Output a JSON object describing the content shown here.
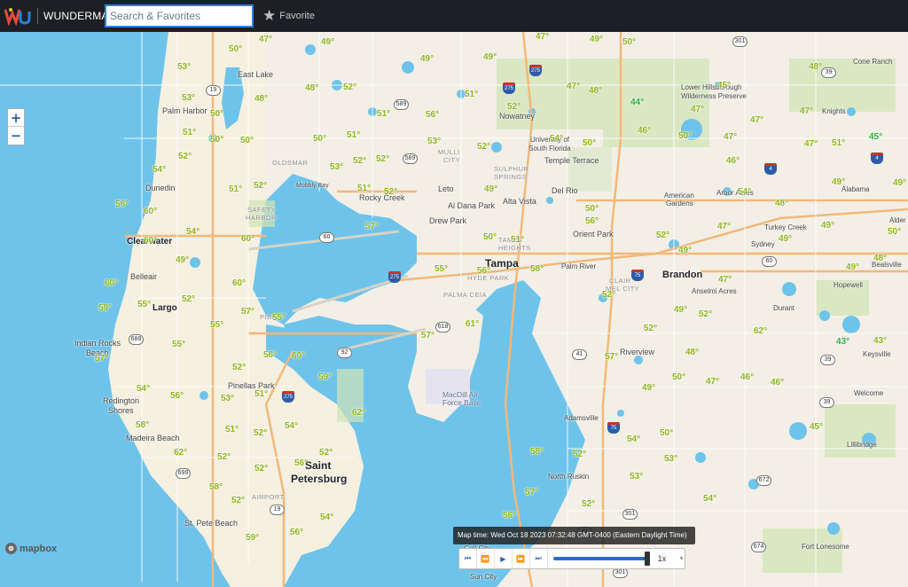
{
  "header": {
    "logo_text": "WUNDERMAP",
    "search_placeholder": "Search & Favorites",
    "favorite_label": "Favorite"
  },
  "map": {
    "attribution": "mapbox",
    "zoom_in": "+",
    "zoom_out": "−",
    "cities_major": [
      {
        "name": "Tampa"
      },
      {
        "name": "Saint"
      },
      {
        "name": "Petersburg"
      },
      {
        "name": "Brandon"
      },
      {
        "name": "Clearwater"
      },
      {
        "name": "Largo"
      }
    ],
    "places": [
      "East Lake",
      "Palm Harbor",
      "Dunedin",
      "Belleair",
      "Indian Rocks",
      "Beach",
      "Redington",
      "Shores",
      "Madeira Beach",
      "Pinellas Park",
      "St. Pete Beach",
      "Oldsmar",
      "Mobbly Bay",
      "Rocky Creek",
      "Leto",
      "Drew Park",
      "Al Dana Park",
      "Alta Vista",
      "Nowatney",
      "University of",
      "South Florida",
      "Temple Terrace",
      "Del Rio",
      "Orient Park",
      "Palm River",
      "Riverview",
      "Adamsville",
      "North Ruskin",
      "Sun City",
      "Lower Hillsborough",
      "Wilderness Preserve",
      "Knights",
      "Cone Ranch",
      "Alabama",
      "American",
      "Gardens",
      "Arbor Acres",
      "Turkey Creek",
      "Sydney",
      "Hopewell",
      "Durant",
      "Anselmi Acres",
      "Keysville",
      "Welcome",
      "Lillibridge",
      "Fort Lonesome",
      "Bealsville",
      "Alder",
      "Mulli",
      "City",
      "MacDill Air",
      "Force Base",
      "Gull City"
    ],
    "districts": [
      "Safety",
      "Harbor",
      "Sulphur",
      "Springs",
      "Tampa",
      "Heights",
      "Hyde Park",
      "Palma Ceia",
      "Clair",
      "Mel City",
      "Pier",
      "Airport",
      "Oldsmar"
    ],
    "shields": [
      "19",
      "589",
      "589",
      "275",
      "60",
      "275",
      "92",
      "688",
      "699",
      "19",
      "618",
      "41",
      "75",
      "75",
      "301",
      "39",
      "39",
      "39",
      "60",
      "672",
      "674",
      "301",
      "301",
      "41",
      "4",
      "4",
      "275",
      "275"
    ],
    "temperatures": [
      "47°",
      "48°",
      "51°",
      "50°",
      "49°",
      "49°",
      "53°",
      "52°",
      "54°",
      "55°",
      "57°",
      "56°",
      "60°",
      "58°",
      "59°",
      "44°",
      "45°",
      "46°",
      "43°",
      "61°",
      "62°"
    ]
  },
  "player": {
    "map_time": "Map time: Wed Oct 18 2023 07:32:48 GMT-0400 (Eastern Daylight Time)",
    "speed": "1x",
    "progress": 1.0
  },
  "colors": {
    "water": "#6ec3ea",
    "land": "#f3efe6",
    "urban": "#f6f0e0",
    "park": "#cfe4b4",
    "road": "#f2b87a",
    "temp": "#8fb51f",
    "temp_cool": "#2eae3f",
    "topbar": "#1d1f24"
  }
}
